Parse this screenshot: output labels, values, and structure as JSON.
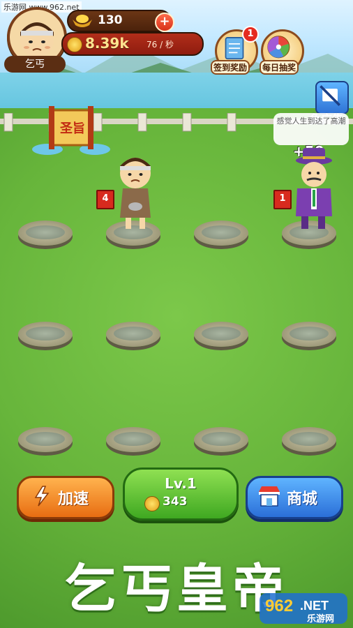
{
  "watermark": {
    "site": "乐游网 www.962.net",
    "logo_number": "962",
    "logo_net": ".NET",
    "logo_name": "乐游网"
  },
  "player": {
    "name": "乞丐",
    "avatar_icon": "beggar-portrait-icon"
  },
  "currency": {
    "gold": "130",
    "coins": "8.39k",
    "rate": "76 / 秒",
    "add_label": "+"
  },
  "top_buttons": {
    "signin": {
      "label": "签到奖励",
      "badge": "1",
      "icon": "scroll-calendar-icon"
    },
    "daily": {
      "label": "每日抽奖",
      "icon": "lucky-wheel-icon"
    },
    "ad": {
      "label": "免广告",
      "icon": "no-ad-icon"
    }
  },
  "edict": {
    "label": "圣旨"
  },
  "bubble": {
    "text": "感觉人生到达了高潮"
  },
  "reward_popup": "+50",
  "units": [
    {
      "name": "beggar",
      "level": "4"
    },
    {
      "name": "merchant",
      "level": "1"
    }
  ],
  "bottom": {
    "speed": {
      "label": "加速",
      "icon": "lightning-icon"
    },
    "level": {
      "label": "Lv.1",
      "cost": "343"
    },
    "shop": {
      "label": "商城",
      "icon": "shop-stall-icon"
    }
  },
  "game_title": "乞丐皇帝",
  "colors": {
    "grass": "#6fb13e",
    "speed": "#f28a22",
    "level": "#5cc234",
    "shop": "#3f8be8",
    "accent_red": "#d82a1e"
  }
}
